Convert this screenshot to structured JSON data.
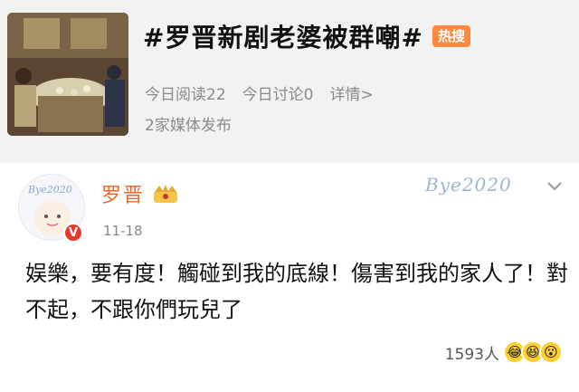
{
  "topic": {
    "hashtag": "#罗晋新剧老婆被群嘲#",
    "badge": "热搜",
    "stats": [
      "今日阅读22",
      "今日讨论0",
      "详情>"
    ],
    "sources": "2家媒体发布"
  },
  "post": {
    "author": "罗晋",
    "verified_mark": "V",
    "time": "11-18",
    "decoration_text": "Bye2020",
    "text": "娱樂，要有度！觸碰到我的底線！傷害到我的家人了！對不起，不跟你們玩兒了",
    "likes": "1593人",
    "reaction_emojis": [
      "😂",
      "😆",
      "😮"
    ]
  },
  "colors": {
    "badge": "#ff8a3d",
    "author": "#e26a2c",
    "verified": "#e73a2b"
  }
}
